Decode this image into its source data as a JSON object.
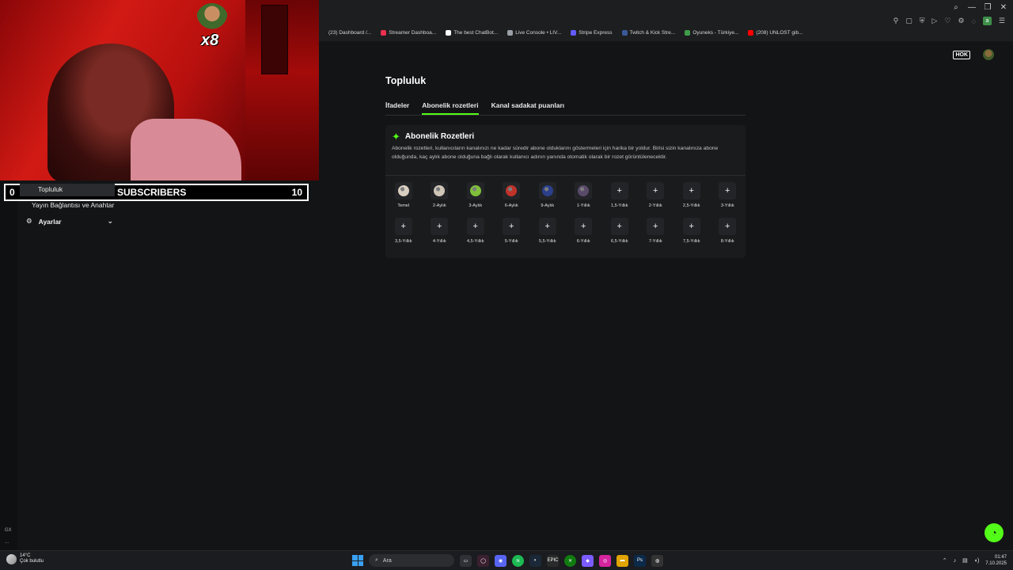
{
  "browser": {
    "bookmarks": [
      {
        "label": "(23) Dashboard /...",
        "color": ""
      },
      {
        "label": "Streamer Dashboa...",
        "color": "#e9304f"
      },
      {
        "label": "The best ChatBot...",
        "color": "#ffffff"
      },
      {
        "label": "Live Console • LIV...",
        "color": "#9aa0a6"
      },
      {
        "label": "Stripe Express",
        "color": "#635bff"
      },
      {
        "label": "Twitch & Kick Stre...",
        "color": "#3b5998"
      },
      {
        "label": "Oyuneks - Türkiye...",
        "color": "#3f9d4a"
      },
      {
        "label": "(208) UNLOST gib...",
        "color": "#ff0000"
      }
    ]
  },
  "header": {
    "logo_text": "HOK"
  },
  "sidebar": {
    "community_label": "Topluluk",
    "stream_key_label": "Yayın Bağlantısı ve Anahtar",
    "settings_label": "Ayarlar"
  },
  "main": {
    "title": "Topluluk",
    "tabs": [
      {
        "label": "İfadeler"
      },
      {
        "label": "Abonelik rozetleri"
      },
      {
        "label": "Kanal sadakat puanları"
      }
    ],
    "card": {
      "title": "Abonelik Rozetleri",
      "description": "Abonelik rozetleri, kullanıcıların kanalınızı ne kadar süredir abone olduklarını göstermeleri için harika bir yoldur. Birisi sizin kanalınıza abone olduğunda, kaç aylık abone olduğuna bağlı olarak kullanıcı adının yanında otomatik olarak bir rozet görüntülenecektir."
    },
    "badges": [
      {
        "label": "Temel",
        "filled": true,
        "color": "#d9cfc0"
      },
      {
        "label": "2-Aylık",
        "filled": true,
        "color": "#cfc6b8"
      },
      {
        "label": "3-Aylık",
        "filled": true,
        "color": "#7fbf3a"
      },
      {
        "label": "6-Aylık",
        "filled": true,
        "color": "#c0322a"
      },
      {
        "label": "9-Aylık",
        "filled": true,
        "color": "#2b3f8a"
      },
      {
        "label": "1-Yıllık",
        "filled": true,
        "color": "#5a4a6a"
      },
      {
        "label": "1,5-Yıllık",
        "filled": false
      },
      {
        "label": "2-Yıllık",
        "filled": false
      },
      {
        "label": "2,5-Yıllık",
        "filled": false
      },
      {
        "label": "3-Yıllık",
        "filled": false
      },
      {
        "label": "3,5-Yıllık",
        "filled": false
      },
      {
        "label": "4-Yıllık",
        "filled": false
      },
      {
        "label": "4,5-Yıllık",
        "filled": false
      },
      {
        "label": "5-Yıllık",
        "filled": false
      },
      {
        "label": "5,5-Yıllık",
        "filled": false
      },
      {
        "label": "6-Yıllık",
        "filled": false
      },
      {
        "label": "6,5-Yıllık",
        "filled": false
      },
      {
        "label": "7-Yıllık",
        "filled": false
      },
      {
        "label": "7,5-Yıllık",
        "filled": false
      },
      {
        "label": "8-Yıllık",
        "filled": false
      }
    ],
    "add_glyph": "+"
  },
  "overlay": {
    "gift_count": "x8",
    "sub_goal_current": "0",
    "sub_goal_title": "SUBSCRIBERS",
    "sub_goal_target": "10"
  },
  "rail": {
    "bottom_text_1": "GX",
    "bottom_text_2": "..."
  },
  "taskbar": {
    "temperature": "14°C",
    "weather_desc": "Çok bulutlu",
    "search_placeholder": "Ara",
    "time": "01:47",
    "date": "7.10.2025",
    "apps": [
      {
        "name": "epic-icon",
        "label": "EPIC",
        "color": "#2a2a2a"
      },
      {
        "name": "photoshop-icon",
        "label": "Ps",
        "color": "#0b2a4a"
      }
    ]
  },
  "colors": {
    "accent": "#53fc18",
    "page_bg": "#131416",
    "card_bg": "#191b1d"
  }
}
